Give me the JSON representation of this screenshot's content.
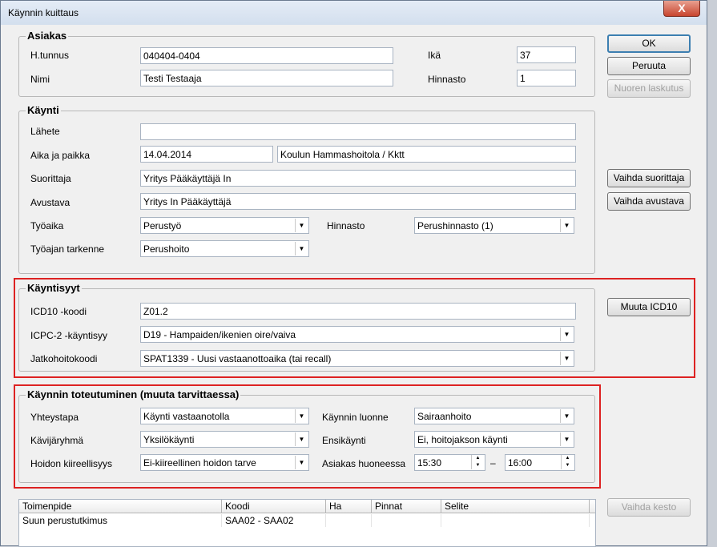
{
  "window": {
    "title": "Käynnin kuittaus",
    "close_label": "X"
  },
  "buttons": {
    "ok": "OK",
    "cancel": "Peruuta",
    "youth_billing": "Nuoren laskutus",
    "change_performer": "Vaihda suorittaja",
    "change_assistant": "Vaihda avustava",
    "change_icd10": "Muuta ICD10",
    "change_duration": "Vaihda kesto"
  },
  "asiakas": {
    "legend": "Asiakas",
    "htunnus_label": "H.tunnus",
    "htunnus": "040404-0404",
    "nimi_label": "Nimi",
    "nimi": "Testi Testaaja",
    "ika_label": "Ikä",
    "ika": "37",
    "hinnasto_label": "Hinnasto",
    "hinnasto": "1"
  },
  "kaynti": {
    "legend": "Käynti",
    "lahete_label": "Lähete",
    "lahete": "",
    "aika_label": "Aika ja paikka",
    "aika": "14.04.2014",
    "paikka": "Koulun Hammashoitola / Kktt",
    "suorittaja_label": "Suorittaja",
    "suorittaja": "Yritys Pääkäyttäjä In",
    "avustava_label": "Avustava",
    "avustava": "Yritys In Pääkäyttäjä",
    "tyoaika_label": "Työaika",
    "tyoaika": "Perustyö",
    "hinnasto_label": "Hinnasto",
    "hinnasto": "Perushinnasto (1)",
    "tarkenne_label": "Työajan tarkenne",
    "tarkenne": "Perushoito"
  },
  "syyt": {
    "legend": "Käyntisyyt",
    "icd10_label": "ICD10 -koodi",
    "icd10": "Z01.2",
    "icpc_label": "ICPC-2 -käyntisyy",
    "icpc": "D19  -  Hampaiden/ikenien oire/vaiva",
    "jatko_label": "Jatkohoitokoodi",
    "jatko": "SPAT1339  -  Uusi vastaanottoaika (tai recall)"
  },
  "toteutuminen": {
    "legend": "Käynnin toteutuminen  (muuta tarvittaessa)",
    "yhteystapa_label": "Yhteystapa",
    "yhteystapa": "Käynti vastaanotolla",
    "kavijaryhma_label": "Kävijäryhmä",
    "kavijaryhma": "Yksilökäynti",
    "kiireellisyys_label": "Hoidon kiireellisyys",
    "kiireellisyys": "Ei-kiireellinen hoidon tarve",
    "luonne_label": "Käynnin luonne",
    "luonne": "Sairaanhoito",
    "ensikaynti_label": "Ensikäynti",
    "ensikaynti": "Ei, hoitojakson käynti",
    "huoneessa_label": "Asiakas huoneessa",
    "alku": "15:30",
    "dash": "–",
    "loppu": "16:00"
  },
  "table": {
    "columns": [
      "Toimenpide",
      "Koodi",
      "Ha",
      "Pinnat",
      "Selite"
    ],
    "rows": [
      [
        "Suun perustutkimus",
        "SAA02 - SAA02",
        "",
        "",
        ""
      ]
    ]
  }
}
